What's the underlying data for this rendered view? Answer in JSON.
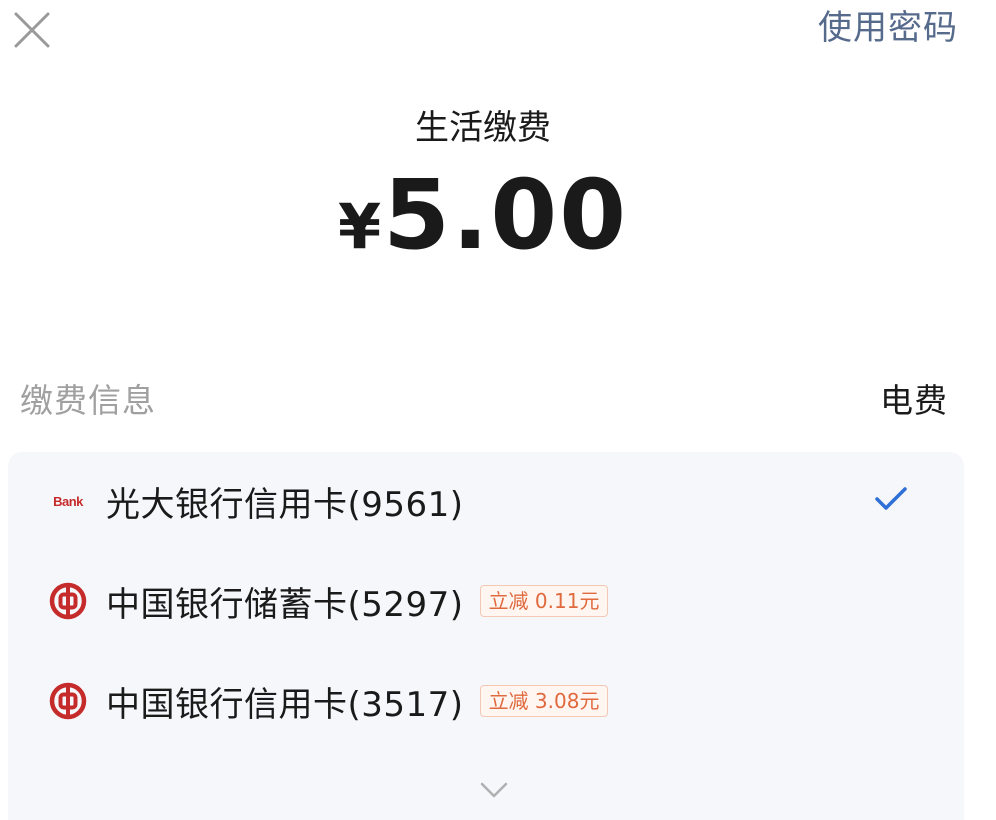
{
  "header": {
    "close_icon": "close-icon",
    "use_password_label": "使用密码"
  },
  "payment": {
    "merchant": "生活缴费",
    "currency_symbol": "¥",
    "amount": "5.00"
  },
  "info": {
    "label": "缴费信息",
    "value": "电费"
  },
  "methods": [
    {
      "name": "光大银行信用卡(9561)",
      "icon": "everbright-bank-icon",
      "icon_text": "Bank",
      "selected": true,
      "discount": ""
    },
    {
      "name": "中国银行储蓄卡(5297)",
      "icon": "bank-of-china-icon",
      "selected": false,
      "discount": "立减 0.11元"
    },
    {
      "name": "中国银行信用卡(3517)",
      "icon": "bank-of-china-icon",
      "selected": false,
      "discount": "立减 3.08元"
    }
  ],
  "colors": {
    "accent": "#2f6fd6",
    "link": "#566a8c",
    "discount_text": "#e0693d",
    "discount_border": "#f5c8b4",
    "boc_red": "#c62b2b",
    "panel_bg": "#f5f7fa"
  }
}
